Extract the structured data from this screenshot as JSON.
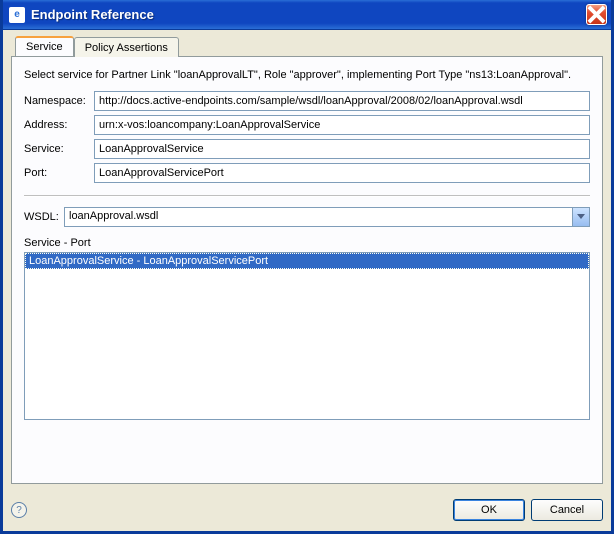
{
  "window": {
    "title": "Endpoint Reference"
  },
  "tabs": {
    "service": "Service",
    "policy": "Policy Assertions"
  },
  "panel": {
    "instruction": "Select service for Partner Link \"loanApprovalLT\", Role \"approver\", implementing Port Type \"ns13:LoanApproval\".",
    "namespace_label": "Namespace:",
    "namespace_value": "http://docs.active-endpoints.com/sample/wsdl/loanApproval/2008/02/loanApproval.wsdl",
    "address_label": "Address:",
    "address_value": "urn:x-vos:loancompany:LoanApprovalService",
    "service_label": "Service:",
    "service_value": "LoanApprovalService",
    "port_label": "Port:",
    "port_value": "LoanApprovalServicePort",
    "wsdl_label": "WSDL:",
    "wsdl_value": "loanApproval.wsdl",
    "listbox_label": "Service - Port",
    "list_items": [
      "LoanApprovalService - LoanApprovalServicePort"
    ]
  },
  "buttons": {
    "ok": "OK",
    "cancel": "Cancel"
  }
}
